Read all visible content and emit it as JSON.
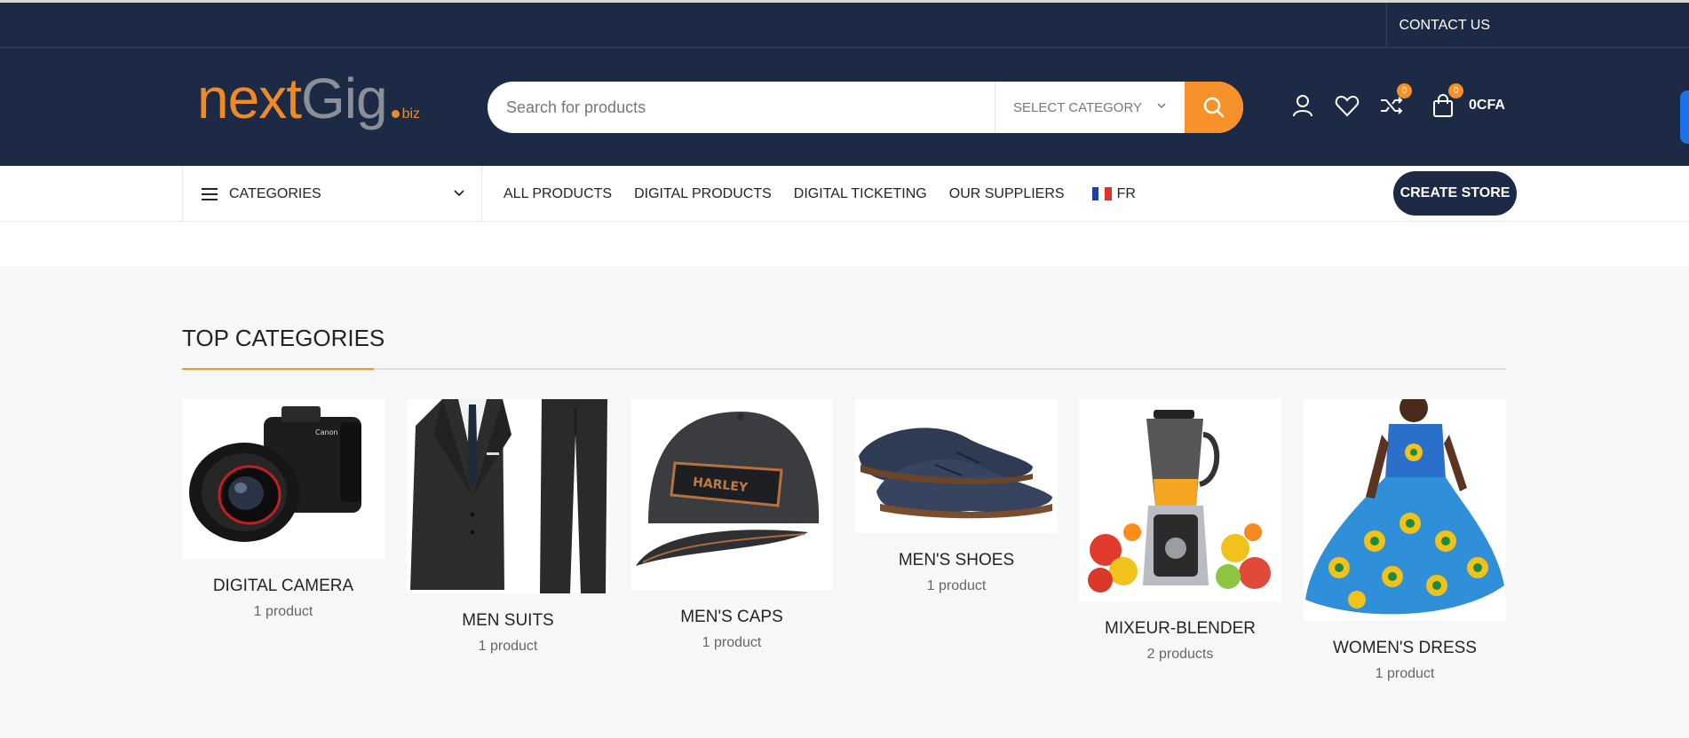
{
  "topbar": {
    "contact_label": "CONTACT US"
  },
  "header": {
    "logo": {
      "part1": "next",
      "part2": "Gig",
      "suffix": "biz"
    },
    "search": {
      "placeholder": "Search for products",
      "category_label": "SELECT CATEGORY"
    },
    "compare_count": "0",
    "cart_count": "0",
    "cart_amount": "0CFA"
  },
  "nav": {
    "categories_label": "CATEGORIES",
    "links": [
      "ALL PRODUCTS",
      "DIGITAL PRODUCTS",
      "DIGITAL TICKETING",
      "OUR SUPPLIERS"
    ],
    "language": "FR",
    "create_store_label": "CREATE STORE"
  },
  "top_categories": {
    "title": "TOP CATEGORIES",
    "items": [
      {
        "name": "DIGITAL CAMERA",
        "count": "1 product"
      },
      {
        "name": "MEN SUITS",
        "count": "1 product"
      },
      {
        "name": "MEN'S CAPS",
        "count": "1 product"
      },
      {
        "name": "MEN'S SHOES",
        "count": "1 product"
      },
      {
        "name": "MIXEUR-BLENDER",
        "count": "2 products"
      },
      {
        "name": "WOMEN'S DRESS",
        "count": "1 product"
      }
    ]
  },
  "colors": {
    "navy": "#1c2a45",
    "accent": "#f7922a",
    "background": "#f7f7f7"
  }
}
